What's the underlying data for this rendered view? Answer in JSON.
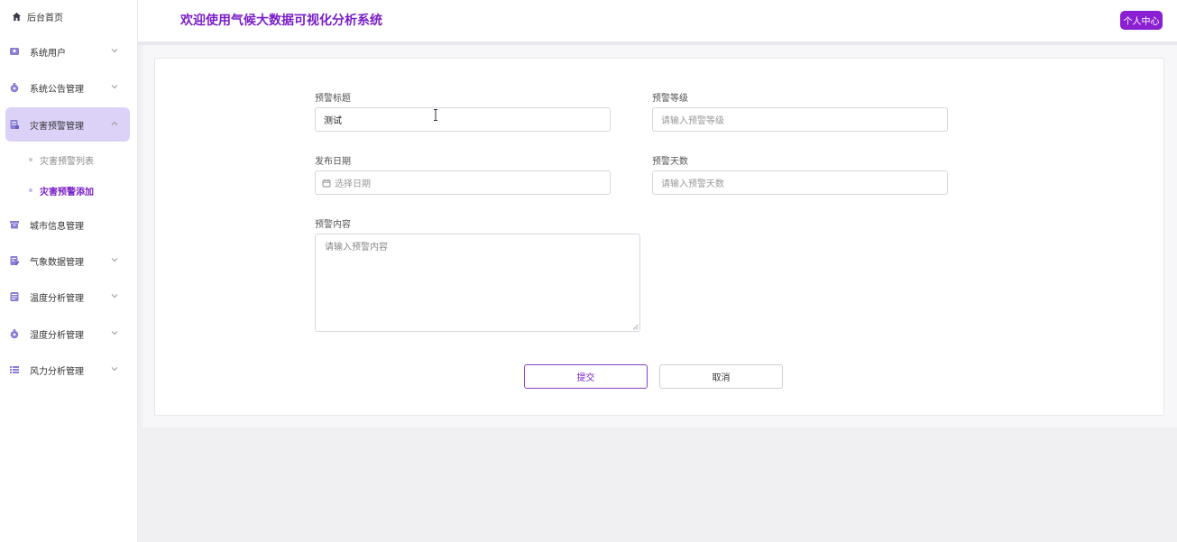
{
  "sidebar": {
    "home_label": "后台首页",
    "items": [
      {
        "label": "系统用户",
        "icon": "user-card-icon"
      },
      {
        "label": "系统公告管理",
        "icon": "flask-icon"
      },
      {
        "label": "灾害预警管理",
        "icon": "document-list-icon"
      },
      {
        "label": "城市信息管理",
        "icon": "archive-box-icon"
      },
      {
        "label": "气象数据管理",
        "icon": "edit-document-icon"
      },
      {
        "label": "温度分析管理",
        "icon": "document-icon"
      },
      {
        "label": "湿度分析管理",
        "icon": "flask-icon"
      },
      {
        "label": "风力分析管理",
        "icon": "list-icon"
      }
    ],
    "sub_items": [
      {
        "label": "灾害预警列表"
      },
      {
        "label": "灾害预警添加"
      }
    ]
  },
  "header": {
    "title": "欢迎使用气候大数据可视化分析系统",
    "profile_button": "个人中心"
  },
  "form": {
    "title_label": "预警标题",
    "title_value": "测试",
    "level_label": "预警等级",
    "level_placeholder": "请输入预警等级",
    "date_label": "发布日期",
    "date_placeholder": "选择日期",
    "days_label": "预警天数",
    "days_placeholder": "请输入预警天数",
    "content_label": "预警内容",
    "content_placeholder": "请输入预警内容",
    "submit_label": "提交",
    "cancel_label": "取消"
  },
  "colors": {
    "accent": "#7a1ec8",
    "active_bg": "#dcd2f8",
    "button_bg": "#8a20d2"
  }
}
